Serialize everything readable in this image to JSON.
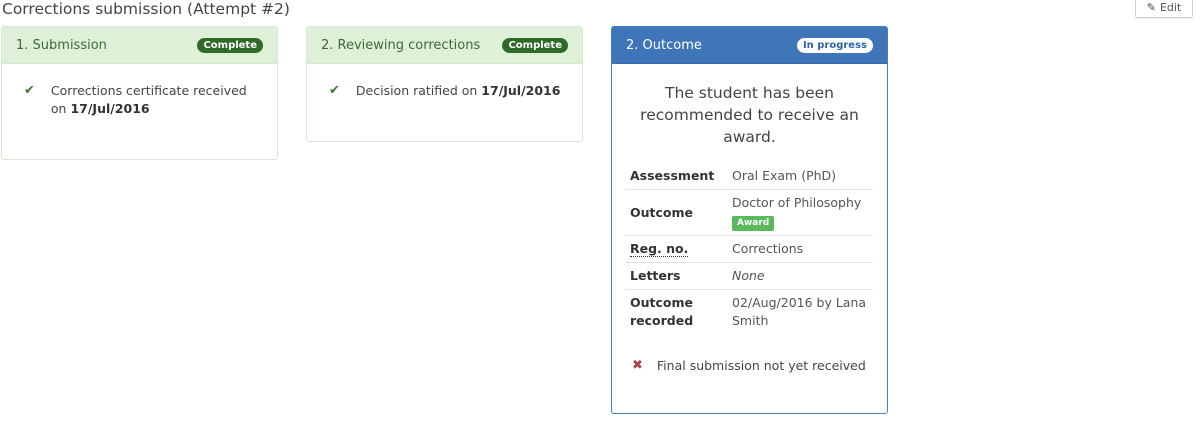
{
  "page": {
    "title": "Corrections submission (Attempt #2)"
  },
  "toolbar": {
    "edit_label": "Edit"
  },
  "cards": {
    "submission": {
      "title": "1. Submission",
      "status": "Complete",
      "item_text": "Corrections certificate received on ",
      "item_date": "17/Jul/2016"
    },
    "reviewing": {
      "title": "2. Reviewing corrections",
      "status": "Complete",
      "item_text": "Decision ratified on ",
      "item_date": "17/Jul/2016"
    },
    "outcome": {
      "title": "2. Outcome",
      "status": "In progress",
      "message": "The student has been recommended to receive an award.",
      "details": {
        "assessment_label": "Assessment",
        "assessment_value": "Oral Exam (PhD)",
        "outcome_label": "Outcome",
        "outcome_value": "Doctor of Philosophy",
        "outcome_badge": "Award",
        "regno_label": "Reg. no.",
        "regno_value": "Corrections",
        "letters_label": "Letters",
        "letters_value": "None",
        "recorded_label": "Outcome recorded",
        "recorded_value": "02/Aug/2016 by Lana Smith"
      },
      "pending_item": "Final submission not yet received"
    }
  },
  "colors": {
    "complete_header_bg": "#dff0d8",
    "complete_badge": "#2e6b27",
    "progress_header_bg": "#3f75b9",
    "award_badge": "#5cb85c",
    "check": "#3b7a33",
    "cross": "#a94442"
  },
  "icons": {
    "edit": "pencil-icon",
    "done": "check-icon",
    "pending": "cross-icon"
  }
}
